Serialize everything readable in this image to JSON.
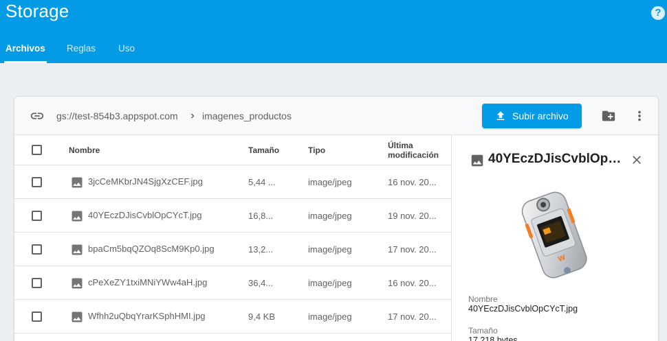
{
  "app": {
    "title": "Storage"
  },
  "tabs": [
    {
      "label": "Archivos"
    },
    {
      "label": "Reglas"
    },
    {
      "label": "Uso"
    }
  ],
  "toolbar": {
    "bucket_path": "gs://test-854b3.appspot.com",
    "folder": "imagenes_productos",
    "upload_label": "Subir archivo"
  },
  "table": {
    "headers": {
      "name": "Nombre",
      "size": "Tamaño",
      "type": "Tipo",
      "modified_line1": "Última",
      "modified_line2": "modificación"
    },
    "rows": [
      {
        "name": "3jcCeMKbrJN4SjgXzCEF.jpg",
        "size": "5,44 ...",
        "type": "image/jpeg",
        "modified": "16 nov. 20..."
      },
      {
        "name": "40YEczDJisCvblOpCYcT.jpg",
        "size": "16,8...",
        "type": "image/jpeg",
        "modified": "19 nov. 20..."
      },
      {
        "name": "bpaCm5bqQZOq8ScM9Kp0.jpg",
        "size": "13,2...",
        "type": "image/jpeg",
        "modified": "17 nov. 20..."
      },
      {
        "name": "cPeXeZY1txiMNiYWw4aH.jpg",
        "size": "36,4...",
        "type": "image/jpeg",
        "modified": "16 nov. 20..."
      },
      {
        "name": "Wfhh2uQbqYrarKSphHMI.jpg",
        "size": "9,4 KB",
        "type": "image/jpeg",
        "modified": "17 nov. 20..."
      }
    ]
  },
  "details": {
    "title": "40YEczDJisCvblOpC...",
    "name_label": "Nombre",
    "name_value": "40YEczDJisCvblOpCYcT.jpg",
    "size_label": "Tamaño",
    "size_value": "17.218 bytes"
  },
  "colors": {
    "primary": "#039be5",
    "background": "#eceff1"
  },
  "icons": [
    "help-icon",
    "link-icon",
    "chevron-right-icon",
    "upload-icon",
    "folder-add-icon",
    "more-vert-icon",
    "image-icon",
    "close-icon"
  ]
}
